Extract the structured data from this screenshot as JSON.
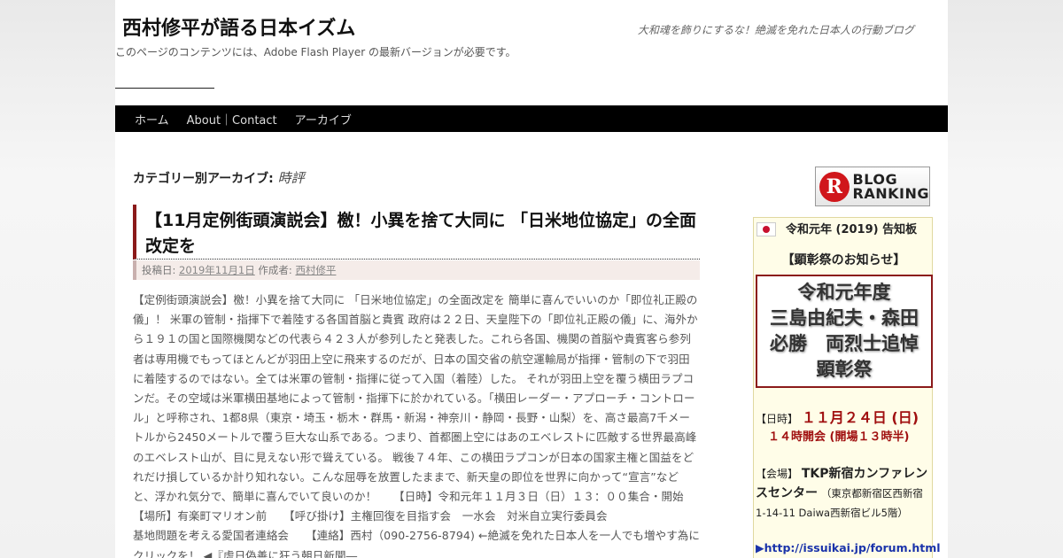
{
  "header": {
    "site_title": "西村修平が語る日本イズム",
    "site_description": "大和魂を飾りにするな！絶滅を免れた日本人の行動ブログ",
    "flash_note": "このページのコンテンツには、Adobe Flash Player の最新バージョンが必要です。"
  },
  "nav": {
    "items": [
      "ホーム",
      "About｜Contact",
      "アーカイブ"
    ]
  },
  "archive": {
    "label": "カテゴリー別アーカイブ:",
    "category": "時評"
  },
  "post": {
    "title": "【11月定例街頭演説会】檄！小異を捨て大同に 「日米地位協定」の全面改定を",
    "meta_prefix": "投稿日:",
    "date": "2019年11月1日",
    "author_prefix": "作成者:",
    "author": "西村修平",
    "body": "【定例街頭演説会】檄！小異を捨て大同に 「日米地位協定」の全面改定を 簡単に喜んでいいのか「即位礼正殿の儀」！ 米軍の管制・指揮下で着陸する各国首脳と貴賓 政府は２２日、天皇陛下の「即位礼正殿の儀」に、海外から１９１の国と国際機関などの代表ら４２３人が参列したと発表した。これら各国、機関の首脳や貴賓客ら参列者は専用機でもってほとんどが羽田上空に飛来するのだが、日本の国交省の航空運輸局が指揮・管制の下で羽田に着陸するのではない。全ては米軍の管制・指揮に従って入国（着陸）した。 それが羽田上空を覆う横田ラプコンだ。その空域は米軍横田基地によって管制・指揮下に於かれている。「横田レーダー・アプローチ・コントロール」と呼称され、1都8県（東京・埼玉・栃木・群馬・新潟・神奈川・静岡・長野・山梨）を、高さ最高7千メートルから2450メートルで覆う巨大な山系である。つまり、首都圏上空にはあのエベレストに匹敵する世界最高峰のエベレスト山が、目に見えない形で聳えている。 戦後７４年、この横田ラプコンが日本の国家主権と国益をどれだけ損しているか計り知れない。こんな屈辱を放置したままで、新天皇の即位を世界に向かって“宣言”などと、浮かれ気分で、簡単に喜んでいて良いのか！　　【日時】令和元年１１月３日（日）１３：００集合・開始　　【場所】有楽町マリオン前　　【呼び掛け】主権回復を目指す会　一水会　対米自立実行委員会　　　　　　　　基地問題を考える愛国者連絡会　　【連絡】西村（090-2756-8794) ←絶滅を免れた日本人を一人でも増やす為にクリックを！ ◀『虐日偽善に狂う朝日新聞―"
  },
  "sidebar": {
    "ranking_banner": {
      "mark": "R",
      "line1": "BLOG",
      "line2": "RANKING"
    },
    "notice": {
      "title": "令和元年 (2019) 告知板",
      "subtitle": "【顕彰祭のお知らせ】",
      "headline_lines": [
        "令和元年度",
        "三島由紀夫・森田",
        "必勝　両烈士追悼",
        "顕彰祭"
      ],
      "date_label": "【日時】",
      "date_value": "１１月２４日 (日)",
      "time_value": "１４時開会 (開場１３時半)",
      "venue_label": "【会場】",
      "venue_name": "TKP新宿カンファレンスセンター",
      "venue_address": "（東京都新宿区西新宿1-14-11 Daiwa西新宿ビル5階）",
      "link_arrow": "▶",
      "link_text": "http://issuikai.jp/forum.html"
    }
  }
}
